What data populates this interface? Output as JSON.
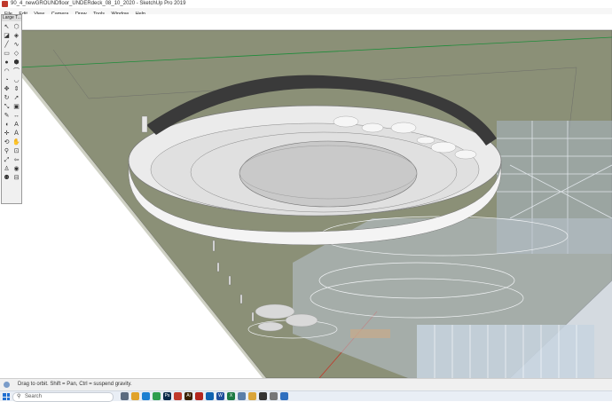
{
  "window": {
    "title": "90_4_newGROUNDfloor_UNDERdeck_08_10_2020 - SketchUp Pro 2019"
  },
  "menu": {
    "items": [
      "File",
      "Edit",
      "View",
      "Camera",
      "Draw",
      "Tools",
      "Window",
      "Help"
    ]
  },
  "toolbar": {
    "title": "Large T...",
    "tools": [
      "select-tool",
      "component-tool",
      "eraser-tool",
      "paint-bucket-tool",
      "line-tool",
      "freehand-tool",
      "rectangle-tool",
      "rotated-rectangle-tool",
      "circle-tool",
      "polygon-tool",
      "arc-tool",
      "two-point-arc-tool",
      "pie-tool",
      "three-point-arc-tool",
      "move-tool",
      "push-pull-tool",
      "rotate-tool",
      "follow-me-tool",
      "scale-tool",
      "offset-tool",
      "tape-measure-tool",
      "dimension-tool",
      "protractor-tool",
      "text-tool",
      "axes-tool",
      "3d-text-tool",
      "orbit-tool",
      "pan-tool",
      "zoom-tool",
      "zoom-window-tool",
      "zoom-extents-tool",
      "previous-view-tool",
      "position-camera-tool",
      "look-around-tool",
      "walk-tool",
      "section-plane-tool"
    ]
  },
  "viewport": {
    "sky_color": "#ffffff",
    "ground_color": "#8b9077",
    "model_description_colors": {
      "ring_outer": "#ebebeb",
      "ring_dark": "#3a3a3a",
      "floor_ring": "#c9c9c9",
      "building": "#a9b6c4"
    }
  },
  "status": {
    "hint": "Drag to orbit. Shift = Pan, Ctrl = suspend gravity."
  },
  "taskbar": {
    "search_placeholder": "Search",
    "apps": [
      {
        "name": "task-view",
        "label": "",
        "color": "#5a6b80"
      },
      {
        "name": "file-explorer",
        "label": "",
        "color": "#e0a22a"
      },
      {
        "name": "edge",
        "label": "",
        "color": "#1c7fd1"
      },
      {
        "name": "chrome",
        "label": "",
        "color": "#2e9e4f"
      },
      {
        "name": "photoshop",
        "label": "Ps",
        "color": "#0a2a4a"
      },
      {
        "name": "sketchup",
        "label": "",
        "color": "#c0392b"
      },
      {
        "name": "illustrator",
        "label": "Ai",
        "color": "#3a2100"
      },
      {
        "name": "acrobat",
        "label": "",
        "color": "#b3261e"
      },
      {
        "name": "outlook",
        "label": "",
        "color": "#0f62b0"
      },
      {
        "name": "word",
        "label": "W",
        "color": "#1f4e9b"
      },
      {
        "name": "excel",
        "label": "X",
        "color": "#1d7a44"
      },
      {
        "name": "layout",
        "label": "",
        "color": "#5b7ea8"
      },
      {
        "name": "folder",
        "label": "",
        "color": "#d9a43a"
      },
      {
        "name": "app-dark",
        "label": "",
        "color": "#333"
      },
      {
        "name": "app-grey",
        "label": "",
        "color": "#777"
      },
      {
        "name": "app-blue",
        "label": "",
        "color": "#2f6fbf"
      }
    ]
  }
}
